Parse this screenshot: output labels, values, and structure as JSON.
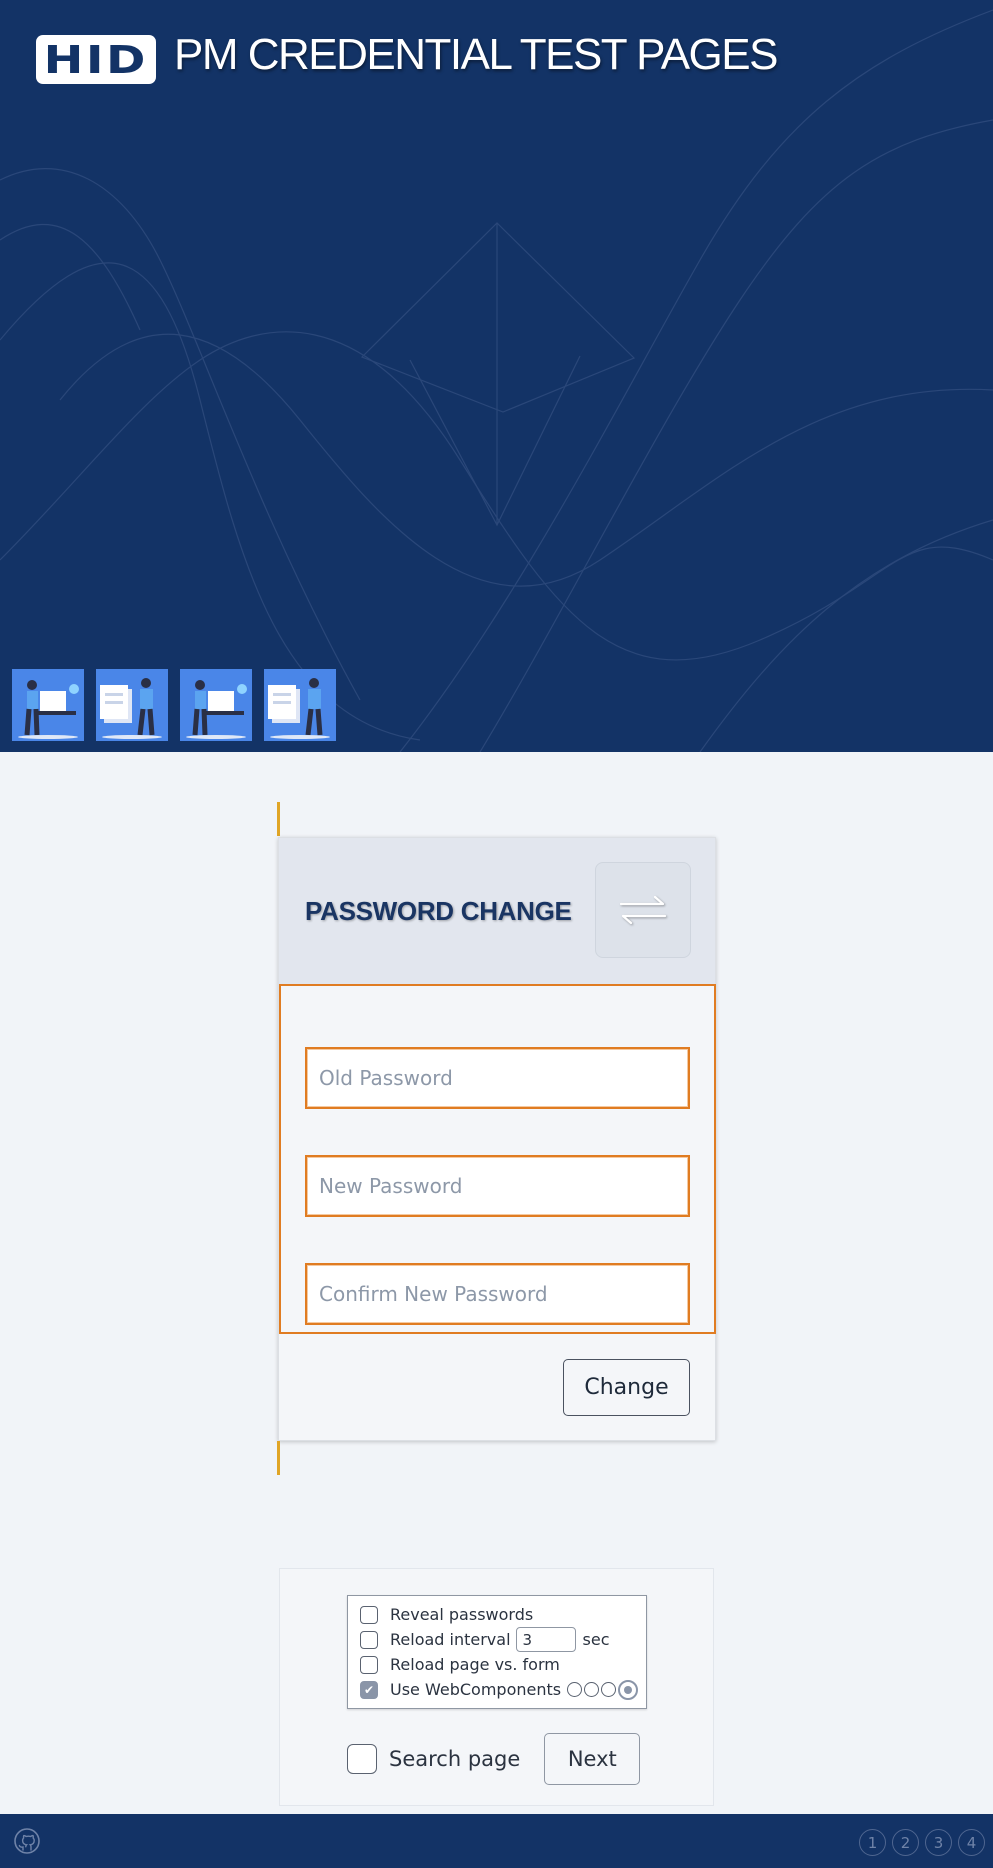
{
  "header": {
    "logo_text": "HID",
    "title": "PM CREDENTIAL TEST PAGES",
    "thumbnails": [
      {
        "name": "thumbnail-login-1"
      },
      {
        "name": "thumbnail-form-2"
      },
      {
        "name": "thumbnail-login-3"
      },
      {
        "name": "thumbnail-form-4"
      }
    ]
  },
  "card": {
    "title": "PASSWORD CHANGE",
    "icon": "swap-arrows-icon",
    "fields": {
      "old_placeholder": "Old Password",
      "new_placeholder": "New Password",
      "confirm_placeholder": "Confirm New Password"
    },
    "submit_label": "Change"
  },
  "options": {
    "reveal_label": "Reveal passwords",
    "reload_interval_label": "Reload interval",
    "reload_interval_value": "3",
    "reload_interval_unit": "sec",
    "reload_page_label": "Reload page vs. form",
    "webcomponents_label": "Use WebComponents",
    "webcomponents_checked": true,
    "search_label": "Search page",
    "next_label": "Next"
  },
  "footer": {
    "github_icon": "github-icon",
    "pages": [
      "1",
      "2",
      "3",
      "4"
    ]
  },
  "colors": {
    "header_bg": "#133366",
    "accent_orange": "#e07c22",
    "accent_yellow": "#e0a526",
    "thumb_bg": "#4a86e8"
  }
}
